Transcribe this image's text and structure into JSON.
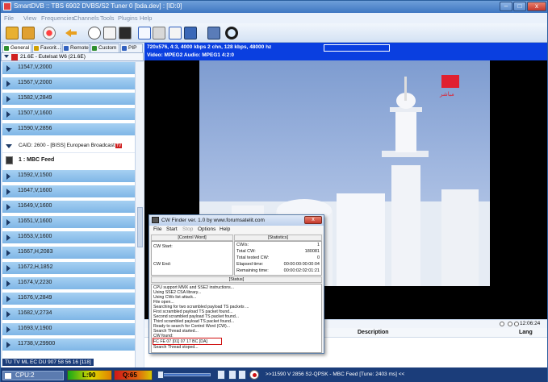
{
  "window": {
    "title": "SmartDVB :: TBS 6902 DVBS/S2 Tuner 0 [bda.dev] : [ID:0]",
    "min_label": "–",
    "max_label": "□",
    "close_label": "x"
  },
  "menu": [
    "File",
    "View",
    "Frequencies",
    "Channels",
    "Tools",
    "Plugins",
    "Help"
  ],
  "toolbar_icons": [
    "open-icon",
    "close-file-icon",
    "record-icon",
    "back-arrow-icon",
    "history-icon",
    "copy-icon",
    "list-icon",
    "monitor-icon",
    "fullscreen-icon",
    "settings-tools-icon",
    "window-icon",
    "tv-icon",
    "capture-icon",
    "zoom-icon"
  ],
  "left_panel": {
    "tabs": [
      {
        "label": "General",
        "color": "#2f8f2f"
      },
      {
        "label": "Favorit...",
        "color": "#d0a000"
      },
      {
        "label": "Remote",
        "color": "#3060c0"
      },
      {
        "label": "Custom",
        "color": "#2f8f2f"
      },
      {
        "label": "PIP",
        "color": "#3060c0"
      }
    ],
    "satellite": "21.6E - Eutelsat W6 (21.6E)",
    "transponders_top": [
      "11547,V,2000",
      "11567,V,2000",
      "11582,V,2849",
      "11507,V,1600"
    ],
    "expanded_transponder": "11590,V,2856",
    "caid_row": "CAID: 2600 - [BISS] European Broadcast",
    "caid_badge": "TV",
    "service": "1 : MBC Feed",
    "transponders_bottom": [
      "11592,V,1500",
      "11647,V,1600",
      "11649,V,1600",
      "11651,V,1600",
      "11653,V,1600",
      "11667,H,2083",
      "11672,H,1852",
      "11674,V,2230",
      "11676,V,2849",
      "11682,V,2734",
      "11693,V,1900",
      "11738,V,29900"
    ]
  },
  "info_bar": {
    "line1": "720x576, 4:3, 4000 kbps   2 chn, 128 kbps, 48000 hz",
    "line2": "Video: MPEG2    Audio: MPEG1    4:2:0"
  },
  "video": {
    "logo_text": "مباشر"
  },
  "playbar": {
    "time": "12:06:24"
  },
  "epg": {
    "description_header": "Description",
    "language_header": "Lang"
  },
  "cw_finder": {
    "title": "CW Finder ver. 1.0 by www.forumsatelit.com",
    "close": "x",
    "menu": [
      {
        "label": "File",
        "enabled": true
      },
      {
        "label": "Start",
        "enabled": true
      },
      {
        "label": "Stop",
        "enabled": false
      },
      {
        "label": "Options",
        "enabled": true
      },
      {
        "label": "Help",
        "enabled": true
      }
    ],
    "control_word_header": "[Control Word]",
    "statistics_header": "[Statistics]",
    "status_header": "[Status]",
    "cw_start_label": "CW Start:",
    "cw_end_label": "CW End:",
    "stats": [
      {
        "label": "CW/s:",
        "value": "1"
      },
      {
        "label": "Total CW:",
        "value": "180081"
      },
      {
        "label": "Total tested CW:",
        "value": "0"
      },
      {
        "label": "Elapsed time:",
        "value": "00:00:00:00:00:04"
      },
      {
        "label": "Remaining time:",
        "value": "00:00:02:02:01:21"
      }
    ],
    "log": [
      "CPU support MMX and SSE2 instructions...",
      "Using SSE2 CSA library...",
      "Using CWs list attack...",
      "File open...",
      "Searching for two scrambled payload TS packets ...",
      "First scrambled payload TS packet found...",
      "Second scrambled payload TS packet found...",
      "Third scrambled payload TS packet found...",
      "Ready to search for Control Word (CW)...",
      "Search Thread started...",
      "CW found:",
      "FC FE 07 [01] 07 17 BC [DA]",
      "Search Thread stoped..."
    ],
    "highlight_index": 11
  },
  "status_bar": {
    "cpu": "CPU:2",
    "level": "L:90",
    "quality": "Q:65",
    "volume_fraction": 0.0,
    "counters": "TU  TV  ML  EC  DU  907  58  56  16 [118]",
    "status_text": ">>11590 V 2856 S2-QPSK - MBC Feed [Tune: 2403 ms] <<"
  }
}
